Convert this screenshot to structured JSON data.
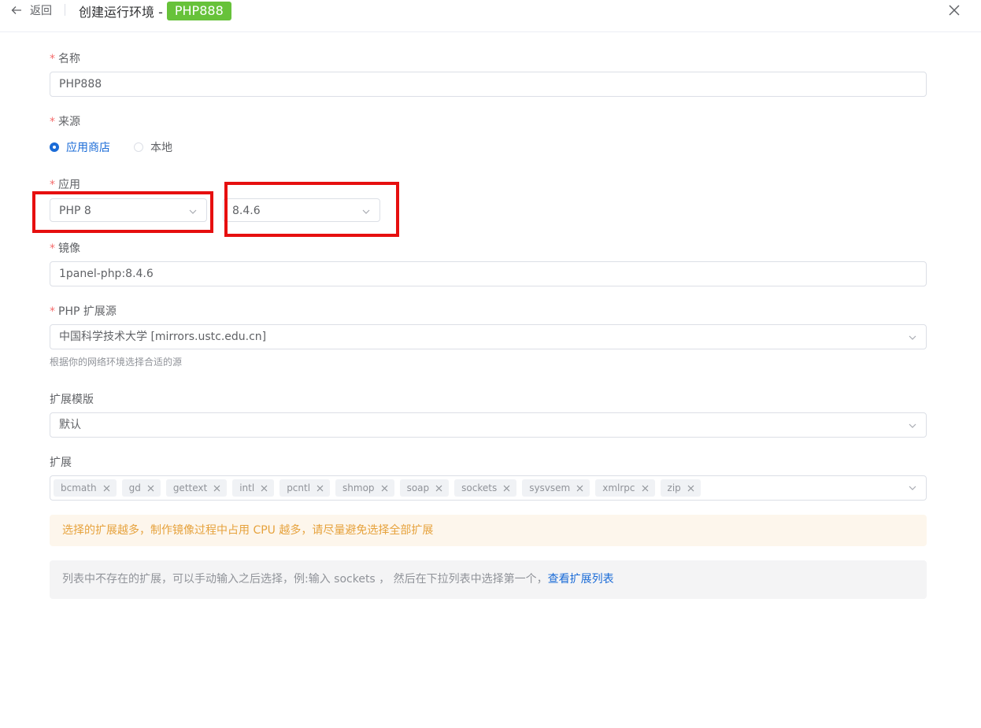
{
  "header": {
    "back_label": "返回",
    "title": "创建运行环境 -",
    "tag": "PHP888"
  },
  "form": {
    "name": {
      "label": "名称",
      "value": "PHP888"
    },
    "source": {
      "label": "来源",
      "options": [
        "应用商店",
        "本地"
      ],
      "selected": "应用商店"
    },
    "app": {
      "label": "应用",
      "app_value": "PHP 8",
      "version_value": "8.4.6"
    },
    "image": {
      "label": "镜像",
      "value": "1panel-php:8.4.6"
    },
    "ext_source": {
      "label": "PHP 扩展源",
      "value": "中国科学技术大学 [mirrors.ustc.edu.cn]",
      "hint": "根据你的网络环境选择合适的源"
    },
    "ext_template": {
      "label": "扩展模版",
      "value": "默认"
    },
    "extensions": {
      "label": "扩展",
      "items": [
        "bcmath",
        "gd",
        "gettext",
        "intl",
        "pcntl",
        "shmop",
        "soap",
        "sockets",
        "sysvsem",
        "xmlrpc",
        "zip"
      ]
    }
  },
  "alerts": {
    "warning": "选择的扩展越多，制作镜像过程中占用 CPU 越多，请尽量避免选择全部扩展",
    "info_text": "列表中不存在的扩展，可以手动输入之后选择，例:输入 sockets ， 然后在下拉列表中选择第一个，",
    "info_link": "查看扩展列表"
  },
  "colors": {
    "accent": "#1a6bd7",
    "tag_green": "#67c23a",
    "required": "#f56c6c",
    "highlight_box": "#e60f0f",
    "warning_text": "#e6a23c"
  }
}
